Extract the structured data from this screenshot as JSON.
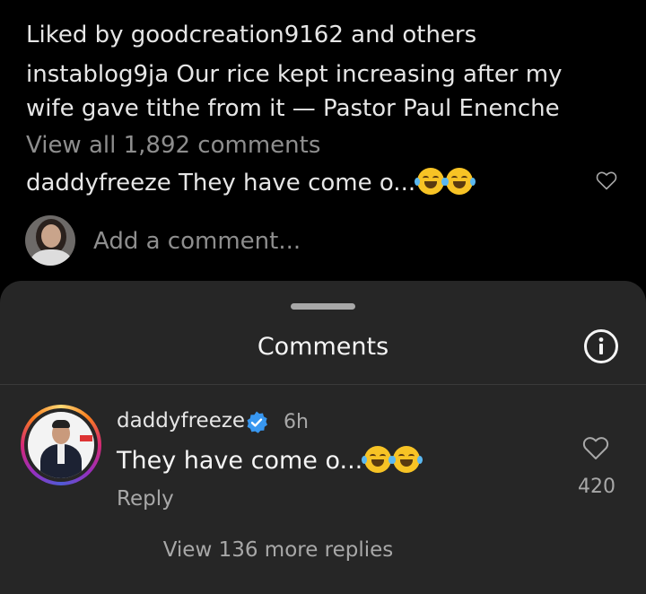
{
  "post": {
    "liked_by": "Liked by goodcreation9162 and others",
    "caption": "instablog9ja Our rice kept increasing after my wife gave tithe from it — Pastor Paul Enenche",
    "view_all": "View all 1,892 comments",
    "preview_comment": "daddyfreeze They have come o...",
    "add_comment_placeholder": "Add a comment..."
  },
  "sheet": {
    "title": "Comments",
    "comment": {
      "username": "daddyfreeze",
      "time": "6h",
      "text": "They have come o...",
      "reply_label": "Reply",
      "likes": "420",
      "view_replies": "View 136 more replies"
    }
  },
  "colors": {
    "background": "#000000",
    "sheet": "#262626",
    "muted": "#a8a8a8",
    "verified": "#3897f0"
  },
  "icons": [
    "heart-icon",
    "info-icon",
    "verified-badge-icon",
    "emoji-tears-of-joy-icon"
  ]
}
